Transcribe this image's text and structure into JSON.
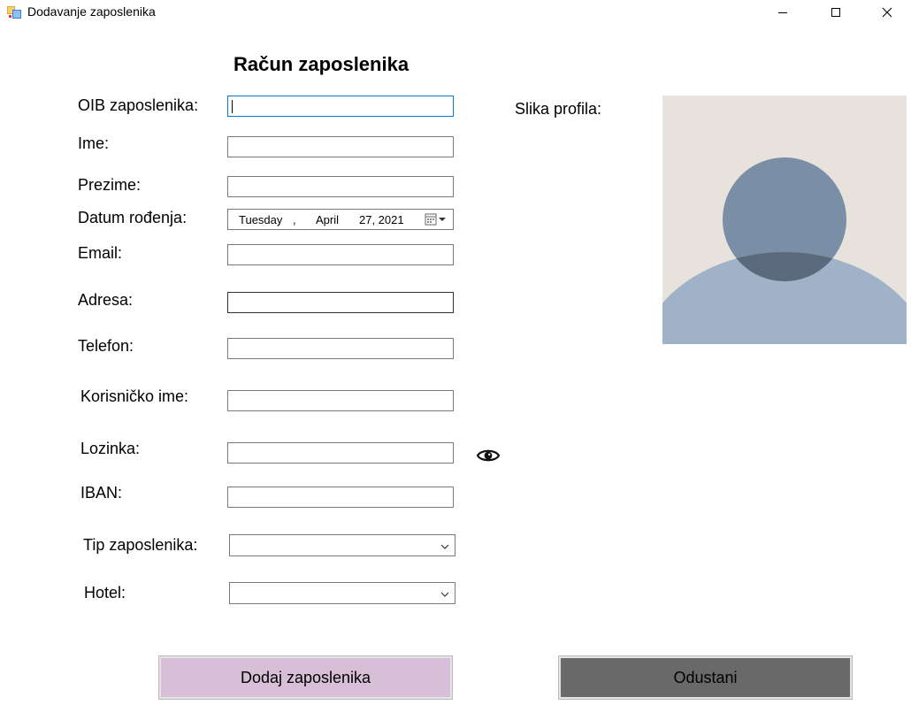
{
  "window": {
    "title": "Dodavanje zaposlenika"
  },
  "form": {
    "heading": "Račun zaposlenika",
    "oib_label": "OIB zaposlenika:",
    "oib_value": "",
    "ime_label": "Ime:",
    "ime_value": "",
    "prezime_label": "Prezime:",
    "prezime_value": "",
    "datum_label": "Datum rođenja:",
    "datum": {
      "weekday": "Tuesday",
      "separator": ",",
      "month": "April",
      "day_year": "27, 2021"
    },
    "email_label": "Email:",
    "email_value": "",
    "adresa_label": "Adresa:",
    "adresa_value": "",
    "telefon_label": "Telefon:",
    "telefon_value": "",
    "korisnicko_label": "Korisničko ime:",
    "korisnicko_value": "",
    "lozinka_label": "Lozinka:",
    "lozinka_value": "",
    "iban_label": "IBAN:",
    "iban_value": "",
    "tip_label": "Tip zaposlenika:",
    "tip_value": "",
    "hotel_label": "Hotel:",
    "hotel_value": ""
  },
  "profile": {
    "label": "Slika profila:",
    "colors": {
      "background": "#e8e2dc",
      "head": "#7a8ea6",
      "body": "#9fb2c8",
      "overlap": "#5a6a7c"
    }
  },
  "buttons": {
    "add_label": "Dodaj zaposlenika",
    "cancel_label": "Odustani",
    "add_color": "#d8bfd8",
    "cancel_color": "#696969"
  },
  "icons": {
    "app": "app-form-icon",
    "minimize": "minimize-icon",
    "maximize": "maximize-icon",
    "close": "close-icon",
    "show_password": "eye-icon",
    "calendar": "calendar-icon",
    "dropdown": "chevron-down-icon"
  }
}
